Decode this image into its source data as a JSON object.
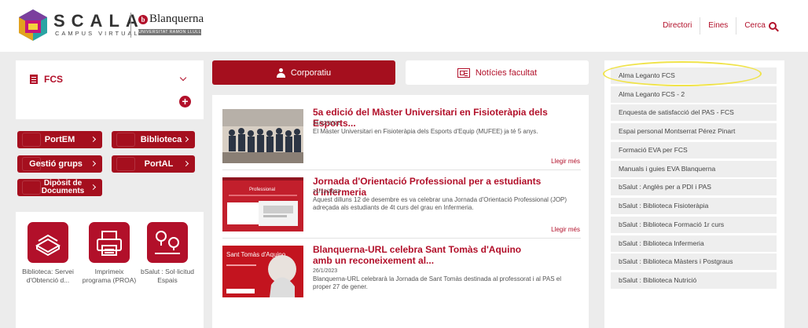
{
  "brand": {
    "scala": "SCALA",
    "campus": "CAMPUS VIRTUAL",
    "blanquerna": "Blanquerna",
    "blanquerna_sub": "UNIVERSITAT RAMON LLULL"
  },
  "topnav": {
    "directori": "Directori",
    "eines": "Eines",
    "cerca": "Cerca"
  },
  "left": {
    "fcs_title": "FCS",
    "buttons": [
      {
        "label": "PortEM"
      },
      {
        "label": "Biblioteca"
      },
      {
        "label": "Gestió grups"
      },
      {
        "label": "PortAL"
      },
      {
        "label": "Dipòsit de Documents"
      }
    ],
    "apps": [
      {
        "label": "Biblioteca: Servei d'Obtenció d...",
        "icon": "books-icon"
      },
      {
        "label": "Imprimeix programa (PROA)",
        "icon": "printer-icon"
      },
      {
        "label": "bSalut : Sol·licitud Espais",
        "icon": "map-pin-icon"
      }
    ]
  },
  "tabs": {
    "corporatiu": "Corporatiu",
    "noticies": "Notícies facultat"
  },
  "news": [
    {
      "title": "5a edició del Màster Universitari en Fisioteràpia dels Esports...",
      "date": "21/12/2022",
      "text": "El Màster Universitari en Fisioteràpia dels Esports d'Equip (MUFEE) ja té 5 anys.",
      "more": "Llegir més"
    },
    {
      "title": "Jornada d'Orientació Professional per a estudiants d'Infermeria",
      "date": "21/12/2022",
      "text": "Aquest dilluns 12 de desembre es va celebrar una Jornada d'Orientació Professional (JOP) adreçada als estudiants de 4t curs del grau en Infermeria.",
      "more": "Llegir més",
      "thumb_text": "Professional"
    },
    {
      "title": "Blanquerna-URL celebra Sant Tomàs d'Aquino amb un reconeixement al...",
      "date": "26/1/2023",
      "text": "Blanquerna-URL celebrarà la Jornada de Sant Tomàs destinada al professorat i al PAS el proper 27 de gener.",
      "thumb_text": "Sant Tomàs d'Aquino"
    }
  ],
  "links": [
    "Alma Leganto FCS",
    "Alma Leganto FCS - 2",
    "Enquesta de satisfacció del PAS - FCS",
    "Espai personal Montserrat Pérez Pinart",
    "Formació EVA per FCS",
    "Manuals i guies EVA Blanquerna",
    "bSalut : Anglès per a PDI i PAS",
    "bSalut : Biblioteca Fisioteràpia",
    "bSalut : Biblioteca Formació 1r curs",
    "bSalut : Biblioteca Infermeria",
    "bSalut : Biblioteca Màsters i Postgraus",
    "bSalut : Biblioteca Nutrició"
  ],
  "colors": {
    "accent": "#b2102a",
    "highlight": "#f0e34a"
  }
}
